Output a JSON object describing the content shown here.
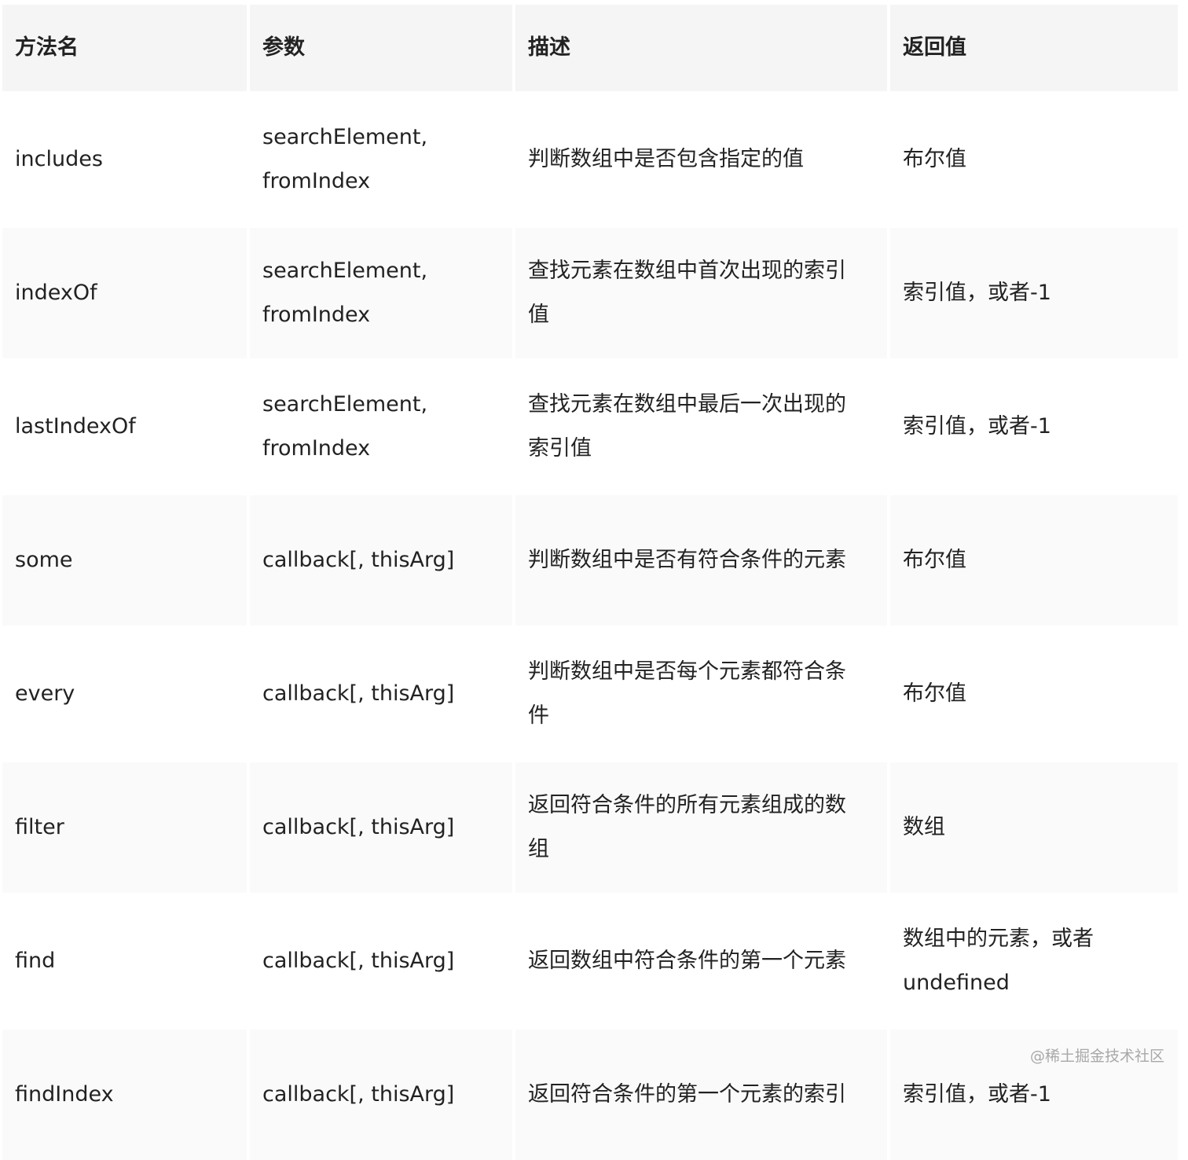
{
  "table": {
    "headers": [
      "方法名",
      "参数",
      "描述",
      "返回值"
    ],
    "rows": [
      {
        "method": "includes",
        "params": "searchElement,\nfromIndex",
        "desc": "判断数组中是否包含指定的值",
        "returns": "布尔值"
      },
      {
        "method": "indexOf",
        "params": "searchElement,\nfromIndex",
        "desc": "查找元素在数组中首次出现的索引\n值",
        "returns": "索引值，或者-1"
      },
      {
        "method": "lastIndexOf",
        "params": "searchElement,\nfromIndex",
        "desc": "查找元素在数组中最后一次出现的\n索引值",
        "returns": "索引值，或者-1"
      },
      {
        "method": "some",
        "params": "callback[, thisArg]",
        "desc": "判断数组中是否有符合条件的元素",
        "returns": "布尔值"
      },
      {
        "method": "every",
        "params": "callback[, thisArg]",
        "desc": "判断数组中是否每个元素都符合条\n件",
        "returns": "布尔值"
      },
      {
        "method": "filter",
        "params": "callback[, thisArg]",
        "desc": "返回符合条件的所有元素组成的数\n组",
        "returns": "数组"
      },
      {
        "method": "find",
        "params": "callback[, thisArg]",
        "desc": "返回数组中符合条件的第一个元素",
        "returns": "数组中的元素，或者\nundefined"
      },
      {
        "method": "findIndex",
        "params": "callback[, thisArg]",
        "desc": "返回符合条件的第一个元素的索引",
        "returns": "索引值，或者-1"
      }
    ]
  },
  "watermark": "@稀土掘金技术社区"
}
